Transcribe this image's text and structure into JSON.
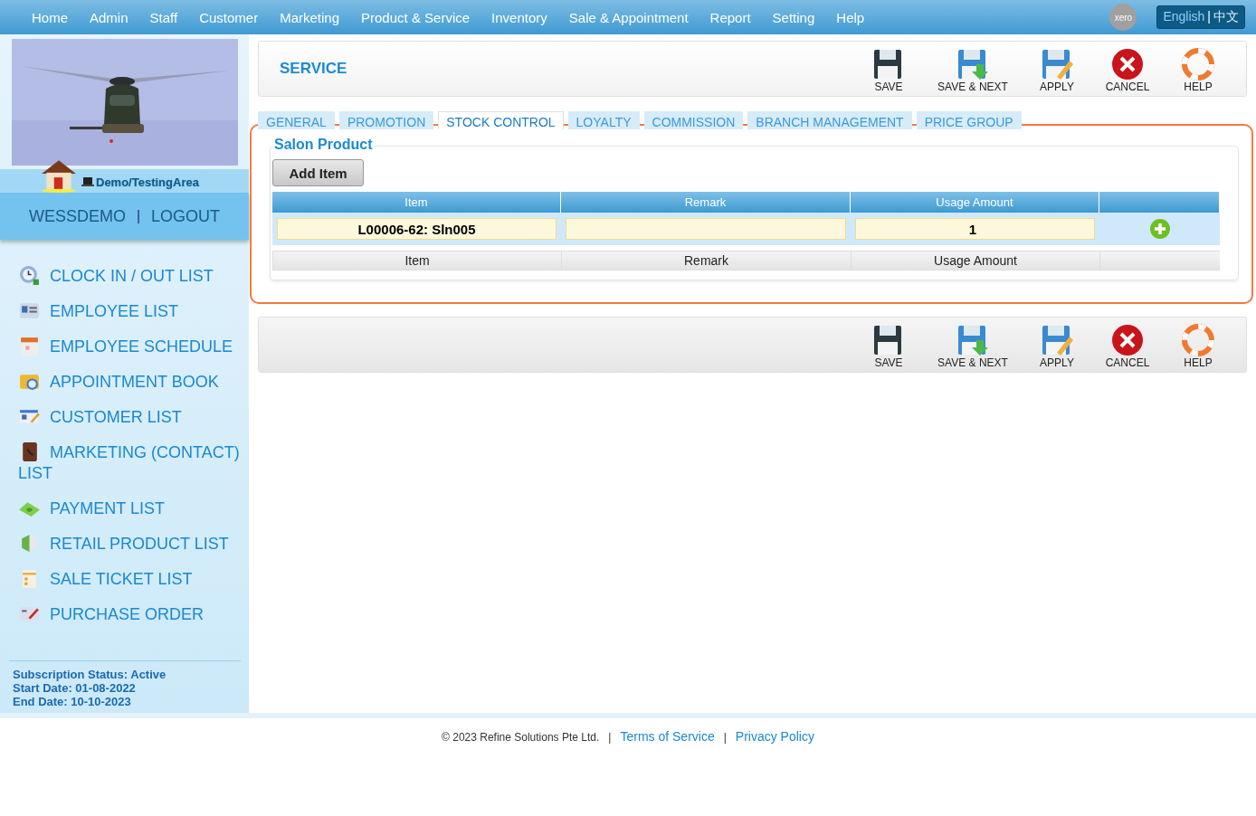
{
  "nav": {
    "items": [
      "Home",
      "Admin",
      "Staff",
      "Customer",
      "Marketing",
      "Product & Service",
      "Inventory",
      "Sale & Appointment",
      "Report",
      "Setting",
      "Help"
    ],
    "badge": "xero",
    "languages": [
      {
        "label": "English",
        "selected": true
      },
      {
        "label": "中文",
        "selected": false
      }
    ],
    "language_separator": "|"
  },
  "sidebar": {
    "area": "Demo/TestingArea",
    "user": "WESSDEMO",
    "separator": "|",
    "logout": "LOGOUT",
    "menu": [
      "CLOCK IN / OUT LIST",
      "EMPLOYEE LIST",
      "EMPLOYEE SCHEDULE",
      "APPOINTMENT BOOK",
      "CUSTOMER LIST",
      "MARKETING (CONTACT) LIST",
      "PAYMENT LIST",
      "RETAIL PRODUCT LIST",
      "SALE TICKET LIST",
      "PURCHASE ORDER"
    ],
    "subscription": [
      "Subscription Status: Active",
      "Start Date: 01-08-2022",
      "End Date: 10-10-2023"
    ]
  },
  "header": {
    "title": "SERVICE",
    "actions": [
      "SAVE",
      "SAVE & NEXT",
      "APPLY",
      "CANCEL",
      "HELP"
    ]
  },
  "tabs": [
    {
      "label": "GENERAL",
      "selected": false
    },
    {
      "label": "PROMOTION",
      "selected": false
    },
    {
      "label": "STOCK CONTROL",
      "selected": true
    },
    {
      "label": "LOYALTY",
      "selected": false
    },
    {
      "label": "COMMISSION",
      "selected": false
    },
    {
      "label": "BRANCH MANAGEMENT",
      "selected": false
    },
    {
      "label": "PRICE GROUP",
      "selected": false
    }
  ],
  "section": {
    "title": "Salon Product",
    "add_button": "Add Item",
    "columns": [
      "Item",
      "Remark",
      "Usage Amount"
    ],
    "row": {
      "item": "L00006-62: Sln005",
      "usage_amount": "1"
    },
    "footer_columns": [
      "Item",
      "Remark",
      "Usage Amount"
    ]
  },
  "bottom_actions": [
    "SAVE",
    "SAVE & NEXT",
    "APPLY",
    "CANCEL",
    "HELP"
  ],
  "footer": {
    "copyright": "© 2023 Refine Solutions Pte Ltd.",
    "separators": [
      "|",
      "|"
    ],
    "links": [
      "Terms of Service",
      "Privacy Policy"
    ]
  }
}
